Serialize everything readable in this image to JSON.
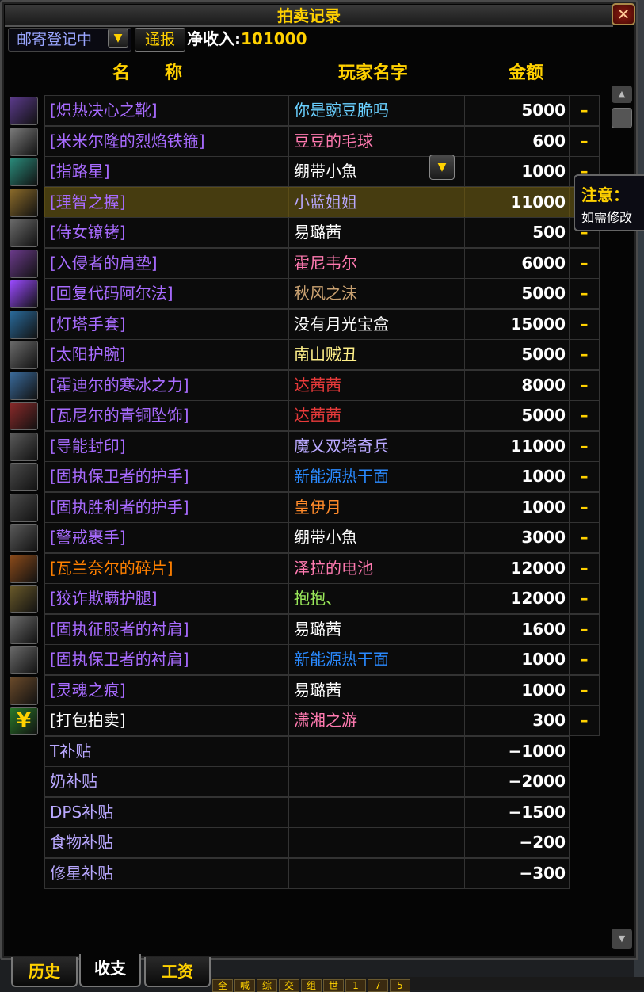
{
  "window": {
    "title": "拍卖记录",
    "close_label": "✕"
  },
  "toolbar": {
    "channel_value": "邮寄登记中",
    "report_label": "通报",
    "income_label": "净收入:",
    "income_value": "101000"
  },
  "columns": {
    "name": "名　　称",
    "player": "玩家名字",
    "amount": "金额"
  },
  "colors": {
    "epic": "#a86bff",
    "legendary": "#ff8000",
    "gold": "#ffd100",
    "white": "#ffffff"
  },
  "items": [
    {
      "icon": "boots-icon",
      "icon_color": "#5a3a8a",
      "name": "[炽热决心之靴]",
      "name_color": "#a86bff",
      "player": "你是豌豆脆吗",
      "player_color": "#6ad0ff",
      "amount": "5000",
      "action": "–"
    },
    {
      "icon": "bracer-icon",
      "icon_color": "#7a7a7a",
      "name": "[米米尔隆的烈焰铁箍]",
      "name_color": "#a86bff",
      "player": "豆豆的毛球",
      "player_color": "#ff7ab0",
      "amount": "600",
      "action": "–"
    },
    {
      "icon": "wand-icon",
      "icon_color": "#2a8a7a",
      "name": "[指路星]",
      "name_color": "#a86bff",
      "player": "绷带小魚",
      "player_color": "#ffffff",
      "amount": "1000",
      "action": "–"
    },
    {
      "icon": "ring-icon",
      "icon_color": "#8a6a2a",
      "name": "[理智之握]",
      "name_color": "#a86bff",
      "player": "小蓝姐姐",
      "player_color": "#b9a8ff",
      "amount": "11000",
      "action": ""
    },
    {
      "icon": "belt-icon",
      "icon_color": "#6a6a6a",
      "name": "[侍女镣铐]",
      "name_color": "#a86bff",
      "player": "易璐茜",
      "player_color": "#ffffff",
      "amount": "500",
      "action": "–"
    },
    {
      "icon": "shoulder-icon",
      "icon_color": "#6a3a8a",
      "name": "[入侵者的肩垫]",
      "name_color": "#a86bff",
      "player": "霍尼韦尔",
      "player_color": "#ff7ab0",
      "amount": "6000",
      "action": "–"
    },
    {
      "icon": "scroll-icon",
      "icon_color": "#9a4aff",
      "name": "[回复代码阿尔法]",
      "name_color": "#a86bff",
      "player": "秋风之沫",
      "player_color": "#c8a070",
      "amount": "5000",
      "action": "–"
    },
    {
      "icon": "gloves-icon",
      "icon_color": "#2a6a9a",
      "name": "[灯塔手套]",
      "name_color": "#a86bff",
      "player": "没有月光宝盒",
      "player_color": "#ffffff",
      "amount": "15000",
      "action": "–"
    },
    {
      "icon": "wrist-icon",
      "icon_color": "#6a6a6a",
      "name": "[太阳护腕]",
      "name_color": "#a86bff",
      "player": "南山贼丑",
      "player_color": "#fff08a",
      "amount": "5000",
      "action": "–"
    },
    {
      "icon": "frost-icon",
      "icon_color": "#3a6a9a",
      "name": "[霍迪尔的寒冰之力]",
      "name_color": "#a86bff",
      "player": "达茜茜",
      "player_color": "#e83a3a",
      "amount": "8000",
      "action": "–"
    },
    {
      "icon": "trinket-icon",
      "icon_color": "#8a2a2a",
      "name": "[瓦尼尔的青铜坠饰]",
      "name_color": "#a86bff",
      "player": "达茜茜",
      "player_color": "#e83a3a",
      "amount": "5000",
      "action": "–"
    },
    {
      "icon": "sigil-icon",
      "icon_color": "#5a5a5a",
      "name": "[导能封印]",
      "name_color": "#a86bff",
      "player": "魔乂双塔奇兵",
      "player_color": "#b9a8ff",
      "amount": "11000",
      "action": "–"
    },
    {
      "icon": "hand-icon",
      "icon_color": "#4a4a4a",
      "name": "[固执保卫者的护手]",
      "name_color": "#a86bff",
      "player": "新能源热干面",
      "player_color": "#2a8aff",
      "amount": "1000",
      "action": "–"
    },
    {
      "icon": "hand-icon",
      "icon_color": "#4a4a4a",
      "name": "[固执胜利者的护手]",
      "name_color": "#a86bff",
      "player": "皇伊月",
      "player_color": "#ff8a2a",
      "amount": "1000",
      "action": "–"
    },
    {
      "icon": "glove-icon",
      "icon_color": "#5a5a5a",
      "name": "[警戒裹手]",
      "name_color": "#a86bff",
      "player": "绷带小魚",
      "player_color": "#ffffff",
      "amount": "3000",
      "action": "–"
    },
    {
      "icon": "shard-icon",
      "icon_color": "#8a4a1a",
      "name": "[瓦兰奈尔的碎片]",
      "name_color": "#ff8000",
      "player": "泽拉的电池",
      "player_color": "#ff7ab0",
      "amount": "12000",
      "action": "–"
    },
    {
      "icon": "legs-icon",
      "icon_color": "#6a5a2a",
      "name": "[狡诈欺瞒护腿]",
      "name_color": "#a86bff",
      "player": "抱抱、",
      "player_color": "#9ae85a",
      "amount": "12000",
      "action": "–"
    },
    {
      "icon": "helm-icon",
      "icon_color": "#6a6a6a",
      "name": "[固执征服者的衬肩]",
      "name_color": "#a86bff",
      "player": "易璐茜",
      "player_color": "#ffffff",
      "amount": "1600",
      "action": "–"
    },
    {
      "icon": "helm-icon",
      "icon_color": "#6a6a6a",
      "name": "[固执保卫者的衬肩]",
      "name_color": "#a86bff",
      "player": "新能源热干面",
      "player_color": "#2a8aff",
      "amount": "1000",
      "action": "–"
    },
    {
      "icon": "dagger-icon",
      "icon_color": "#6a4a2a",
      "name": "[灵魂之痕]",
      "name_color": "#a86bff",
      "player": "易璐茜",
      "player_color": "#ffffff",
      "amount": "1000",
      "action": "–"
    },
    {
      "icon": "yen-icon",
      "icon_color": "#2a7a2a",
      "icon_glyph": "¥",
      "name": "[打包拍卖]",
      "name_color": "#ffffff",
      "player": "潇湘之游",
      "player_color": "#ff7ab0",
      "amount": "300",
      "action": "–"
    }
  ],
  "subsidies": [
    {
      "name": "T补贴",
      "amount": "−1000"
    },
    {
      "name": "奶补贴",
      "amount": "−2000"
    },
    {
      "name": "DPS补贴",
      "amount": "−1500"
    },
    {
      "name": "食物补贴",
      "amount": "−200"
    },
    {
      "name": "修星补贴",
      "amount": "−300"
    }
  ],
  "highlighted_row": 3,
  "tooltip": {
    "title": "注意：",
    "text": "如需修改"
  },
  "tabs": [
    {
      "label": "历史",
      "active": false
    },
    {
      "label": "收支",
      "active": true
    },
    {
      "label": "工资",
      "active": false
    }
  ],
  "actionbar": [
    "全",
    "喊",
    "综",
    "交",
    "组",
    "世",
    "1",
    "7",
    "5"
  ]
}
